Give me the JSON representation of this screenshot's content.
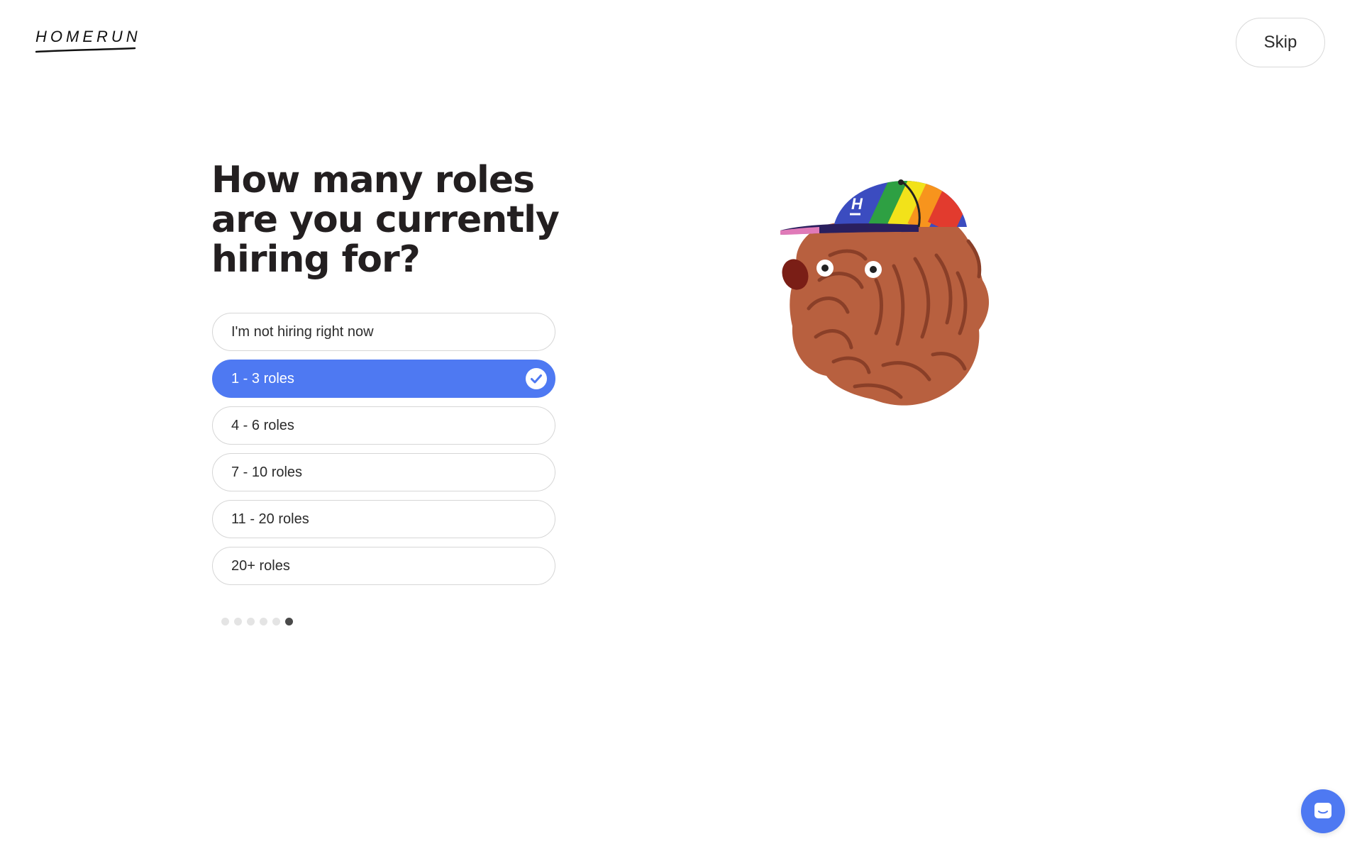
{
  "brand": {
    "logo_text": "HOMERUN"
  },
  "header": {
    "skip_label": "Skip"
  },
  "question": {
    "title": "How many roles are you currently hiring for?"
  },
  "options": [
    {
      "label": "I'm not hiring right now",
      "selected": false
    },
    {
      "label": "1 - 3 roles",
      "selected": true
    },
    {
      "label": "4 - 6 roles",
      "selected": false
    },
    {
      "label": "7 - 10 roles",
      "selected": false
    },
    {
      "label": "11 - 20 roles",
      "selected": false
    },
    {
      "label": "20+ roles",
      "selected": false
    }
  ],
  "progress": {
    "total_steps": 6,
    "current_step": 6
  },
  "icons": {
    "check": "check-circle-icon",
    "chat": "chat-bubble-icon",
    "illustration": "bulldog-rainbow-cap-illustration"
  },
  "colors": {
    "accent": "#4e79f2",
    "text": "#231f20",
    "border": "#d6d6d6",
    "dot_inactive": "#e4e4e4",
    "dot_active": "#4a4a4a"
  }
}
